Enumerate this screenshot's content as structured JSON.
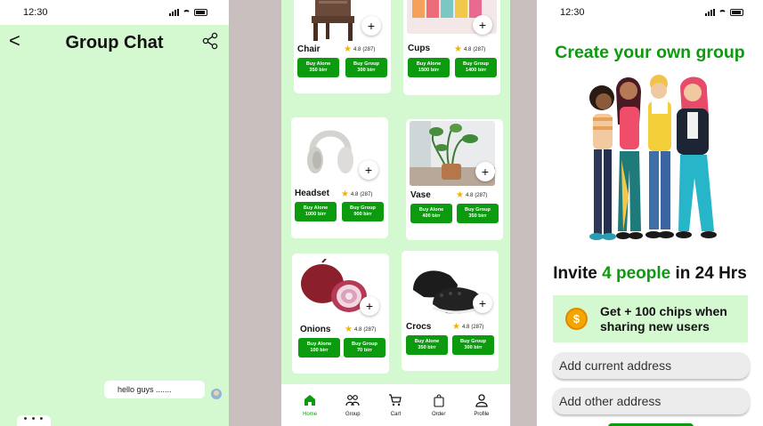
{
  "chat": {
    "time": "12:30",
    "title": "Group Chat",
    "message": "hello guys .......",
    "typing": "• • •"
  },
  "shop": {
    "products": [
      {
        "name": "Chair",
        "rating": "4.8",
        "reviews": "(287)",
        "buy_alone": "Buy Alone",
        "alone_price": "350 birr",
        "buy_group": "Buy Group",
        "group_price": "300 birr"
      },
      {
        "name": "Cups",
        "rating": "4.8",
        "reviews": "(287)",
        "buy_alone": "Buy Alone",
        "alone_price": "1500 birr",
        "buy_group": "Buy Group",
        "group_price": "1400 birr"
      },
      {
        "name": "Headset",
        "rating": "4.8",
        "reviews": "(287)",
        "buy_alone": "Buy Alone",
        "alone_price": "1000 birr",
        "buy_group": "Buy Group",
        "group_price": "900 birr"
      },
      {
        "name": "Vase",
        "rating": "4.8",
        "reviews": "(287)",
        "buy_alone": "Buy Alone",
        "alone_price": "400 birr",
        "buy_group": "Buy Group",
        "group_price": "350 birr"
      },
      {
        "name": "Onions",
        "rating": "4.8",
        "reviews": "(287)",
        "buy_alone": "Buy Alone",
        "alone_price": "100 birr",
        "buy_group": "Buy Group",
        "group_price": "70 birr"
      },
      {
        "name": "Crocs",
        "rating": "4.8",
        "reviews": "(287)",
        "buy_alone": "Buy Alone",
        "alone_price": "350 birr",
        "buy_group": "Buy Group",
        "group_price": "300 birr"
      }
    ],
    "nav": [
      {
        "label": "Home",
        "icon": "home-icon",
        "active": true
      },
      {
        "label": "Group",
        "icon": "group-icon"
      },
      {
        "label": "Cart",
        "icon": "cart-icon"
      },
      {
        "label": "Order",
        "icon": "bag-icon"
      },
      {
        "label": "Profile",
        "icon": "user-icon"
      }
    ],
    "accent": "#0c9b0f"
  },
  "create": {
    "time": "12:30",
    "title": "Create your own group",
    "invite_pre": "Invite ",
    "invite_count": "4 people",
    "invite_post": " in 24 Hrs",
    "chips_text": "Get + 100 chips when sharing new users",
    "current_address_placeholder": "Add current address",
    "other_address_placeholder": "Add other address"
  }
}
